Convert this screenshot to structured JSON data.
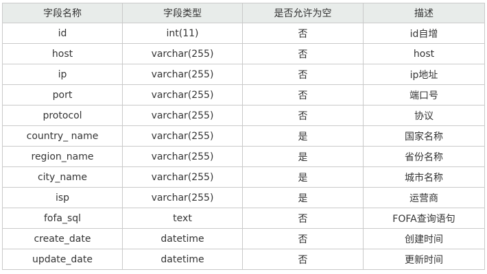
{
  "table": {
    "headers": [
      "字段名称",
      "字段类型",
      "是否允许为空",
      "描述"
    ],
    "rows": [
      [
        "id",
        "int(11)",
        "否",
        "id自增"
      ],
      [
        "host",
        "varchar(255)",
        "否",
        "host"
      ],
      [
        "ip",
        "varchar(255)",
        "否",
        "ip地址"
      ],
      [
        "port",
        "varchar(255)",
        "否",
        "端口号"
      ],
      [
        "protocol",
        "varchar(255)",
        "否",
        "协议"
      ],
      [
        "country_ name",
        "varchar(255)",
        "是",
        "国家名称"
      ],
      [
        "region_name",
        "varchar(255)",
        "是",
        "省份名称"
      ],
      [
        "city_name",
        "varchar(255)",
        "是",
        "城市名称"
      ],
      [
        "isp",
        "varchar(255)",
        "是",
        "运营商"
      ],
      [
        "fofa_sql",
        "text",
        "否",
        "FOFA查询语句"
      ],
      [
        "create_date",
        "datetime",
        "否",
        "创建时间"
      ],
      [
        "update_date",
        "datetime",
        "否",
        "更新时间"
      ]
    ],
    "colors": {
      "header_bg": "#e8ecea",
      "border": "#c9c9c9",
      "text": "#333333"
    }
  }
}
